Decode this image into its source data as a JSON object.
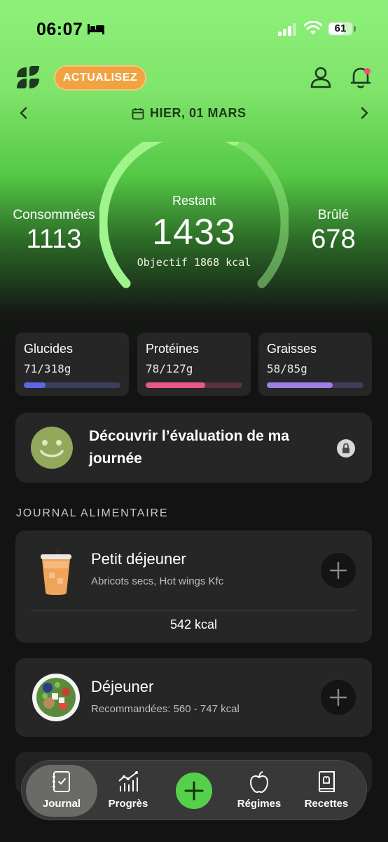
{
  "status_bar": {
    "time": "06:07",
    "battery": "61"
  },
  "header": {
    "upgrade_label": "ACTUALISEZ",
    "date": "HIER, 01 MARS"
  },
  "calories": {
    "consumed_label": "Consommées",
    "consumed_value": "1113",
    "remaining_label": "Restant",
    "remaining_value": "1433",
    "goal_text": "Objectif 1868 kcal",
    "burned_label": "Brûlé",
    "burned_value": "678",
    "ring_progress": 0.6
  },
  "macros": [
    {
      "label": "Glucides",
      "value": "71/318g",
      "fraction": 0.223,
      "color": "#5b67e3"
    },
    {
      "label": "Protéines",
      "value": "78/127g",
      "fraction": 0.614,
      "color": "#e8588c"
    },
    {
      "label": "Graisses",
      "value": "58/85g",
      "fraction": 0.682,
      "color": "#a07ee8"
    }
  ],
  "evaluation": {
    "text": "Découvrir l’évaluation de ma journée"
  },
  "journal": {
    "title": "JOURNAL ALIMENTAIRE",
    "meals": [
      {
        "name": "Petit déjeuner",
        "subtitle": "Abricots secs, Hot wings Kfc",
        "kcal": "542 kcal"
      },
      {
        "name": "Déjeuner",
        "subtitle": "Recommandées: 560 - 747  kcal"
      }
    ]
  },
  "nav": {
    "items": [
      {
        "label": "Journal",
        "icon": "journal-icon"
      },
      {
        "label": "Progrès",
        "icon": "progress-chart-icon"
      },
      {
        "label": "Régimes",
        "icon": "apple-icon"
      },
      {
        "label": "Recettes",
        "icon": "recipe-book-icon"
      }
    ],
    "active": "Journal"
  },
  "colors": {
    "accent": "#55d04a",
    "upgrade": "#f0a340",
    "card": "#262626"
  }
}
